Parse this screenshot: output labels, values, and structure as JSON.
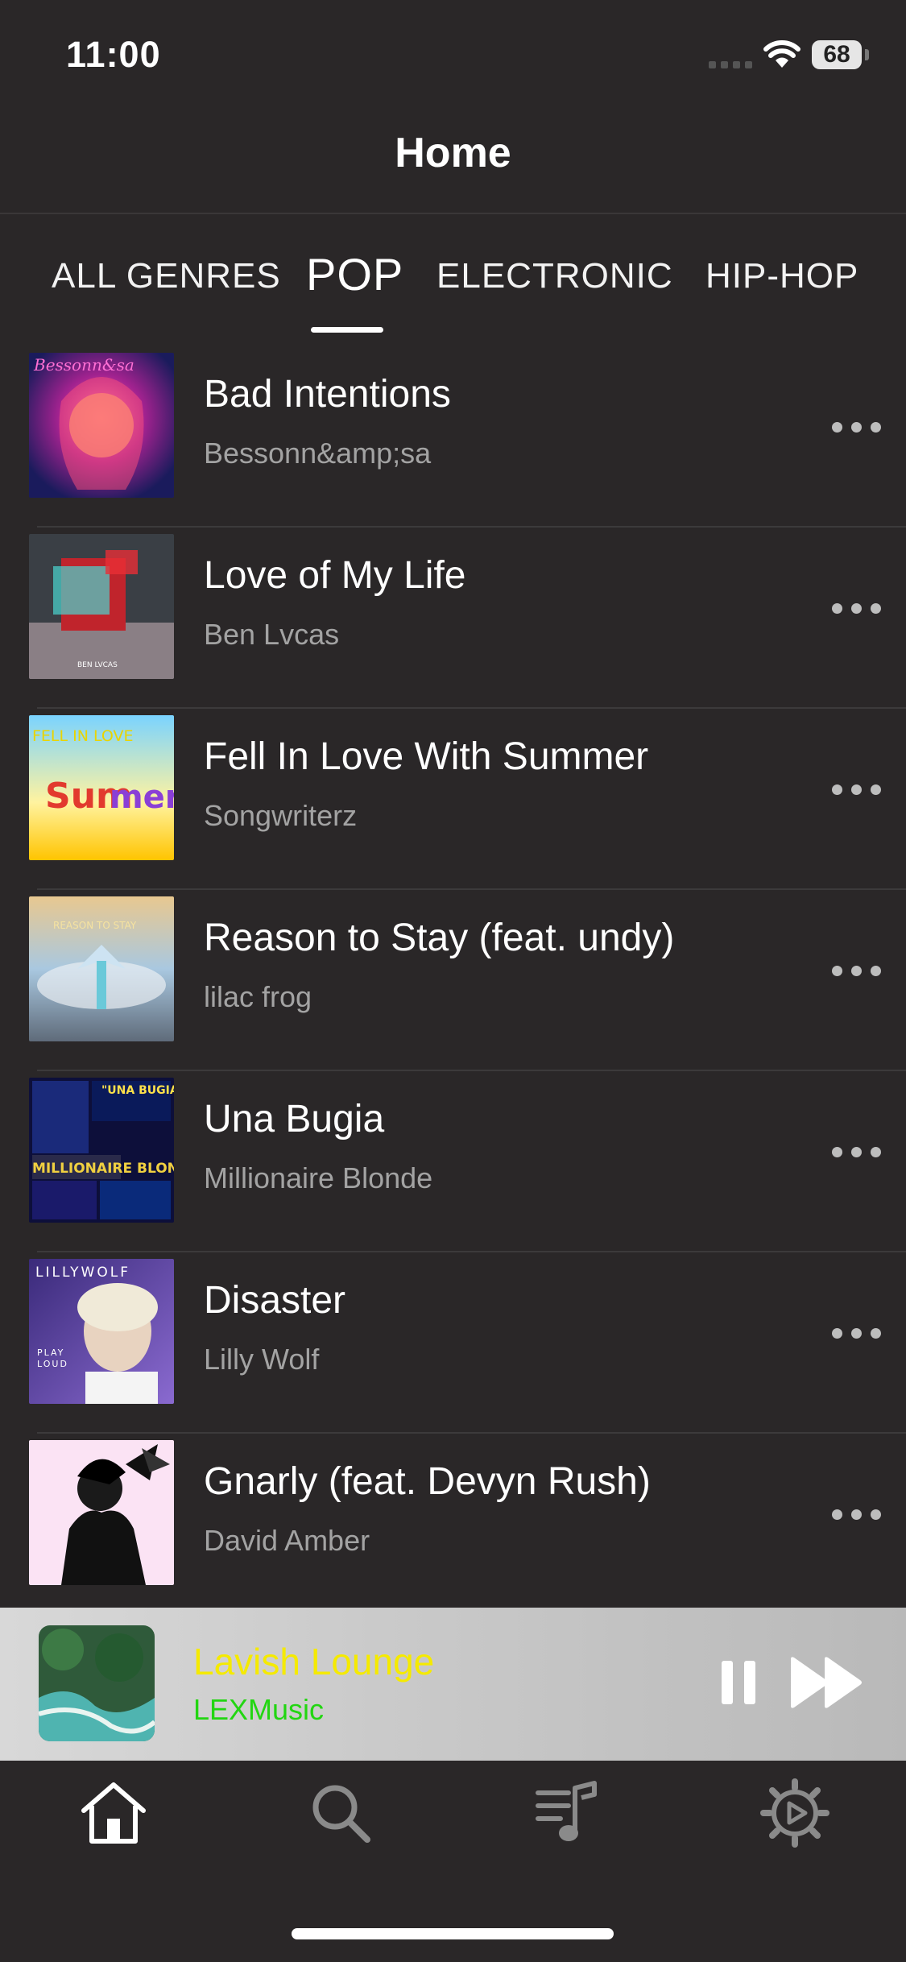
{
  "status_bar": {
    "time": "11:00",
    "battery": "68"
  },
  "nav": {
    "title": "Home"
  },
  "tabs": [
    {
      "label": "ALL GENRES",
      "active": false
    },
    {
      "label": "POP",
      "active": true
    },
    {
      "label": "ELECTRONIC",
      "active": false
    },
    {
      "label": "HIP-HOP",
      "active": false
    }
  ],
  "songs": [
    {
      "title": "Bad Intentions",
      "artist": "Bessonn&amp;sa",
      "art_text": "Bessonn&sa"
    },
    {
      "title": "Love of My Life",
      "artist": "Ben Lvcas",
      "art_text": "BEN LVCAS"
    },
    {
      "title": "Fell In Love With Summer",
      "artist": "Songwriterz",
      "art_text": "FELL IN LOVE"
    },
    {
      "title": "Reason to Stay (feat. undy)",
      "artist": "lilac frog",
      "art_text": "REASON TO STAY"
    },
    {
      "title": "Una Bugia",
      "artist": "Millionaire Blonde",
      "art_text": "\"UNA BUGIA\""
    },
    {
      "title": "Disaster",
      "artist": "Lilly Wolf",
      "art_text": "LILLYWOLF"
    },
    {
      "title": "Gnarly (feat. Devyn Rush)",
      "artist": "David Amber",
      "art_text": ""
    }
  ],
  "mini_player": {
    "title": "Lavish Lounge",
    "artist": "LEXMusic",
    "title_color": "#f5ea00",
    "artist_color": "#22d611"
  },
  "tab_bar": [
    {
      "icon": "home-icon",
      "active": true
    },
    {
      "icon": "search-icon",
      "active": false
    },
    {
      "icon": "playlist-icon",
      "active": false
    },
    {
      "icon": "settings-icon",
      "active": false
    }
  ],
  "colors": {
    "background": "#2a2728",
    "secondary_text": "#a3a3a3",
    "accent_inactive": "#8a8a8a"
  }
}
